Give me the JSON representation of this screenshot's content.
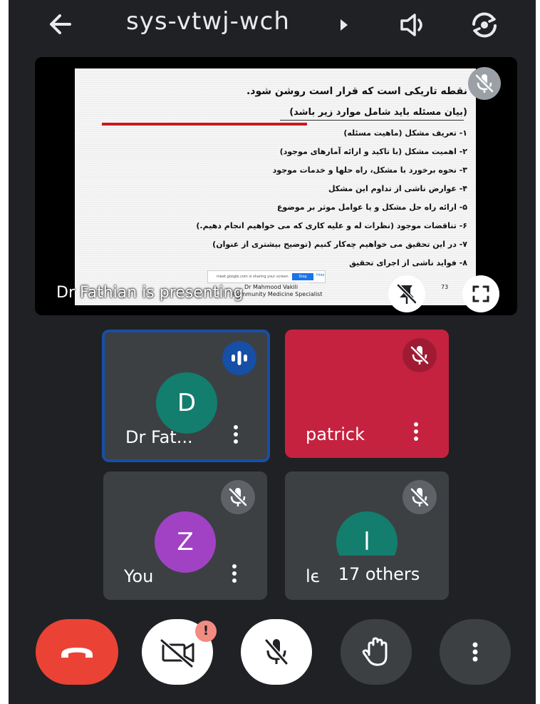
{
  "header": {
    "title": "sys-vtwj-wch"
  },
  "presentation": {
    "presenter_label": "Dr Fathian is presenting",
    "slide": {
      "lines": [
        "نقطه تاریکی  است که قرار است روشن شود.",
        "(بیان مسئله باید شامل موارد زیر باشد)",
        "۱- تعریف مشکل (ماهیت مسئله)",
        "۲- اهمیت مشکل (با تاکید و ارائه آمارهای موجود)",
        "۳- نحوه برخورد با مشکل، راه حلها و خدمات موجود",
        "۴- عوارض ناشی از تداوم این مشکل",
        "۵- ارائه راه حل مشکل و یا عوامل موثر بر موضوع",
        "۶- تناقضات موجود (نظرات له و علیه کاری که می خواهیم انجام دهیم.)",
        "۷- در این تحقیق می خواهیم چه‌کار کنیم (توضیح بیشتری از عنوان)",
        "۸- فواید ناشی از اجرای تحقیق"
      ],
      "share_bar_text": "meet.google.com is sharing your screen",
      "share_stop": "Stop sharing",
      "share_hide": "Hide",
      "author_line1": "Dr Mahmood Vakili",
      "author_line2": "Community Medicine Specialist",
      "page_number": "73"
    }
  },
  "participants": [
    {
      "name": "Dr Fat...",
      "initial": "D",
      "avatar_color": "#137d6e",
      "speaking": true
    },
    {
      "name": "patrick",
      "muted": true
    },
    {
      "name": "You",
      "initial": "Z",
      "avatar_color": "#a142c4",
      "muted": true
    },
    {
      "name": "leila",
      "initial": "l",
      "avatar_color": "#137d6e",
      "muted": true
    }
  ],
  "others_label": "17 others",
  "colors": {
    "background": "#202124",
    "tile": "#3c4043",
    "patrick_tile": "#c5223f",
    "active_border": "#174ea6",
    "hangup": "#ea4335"
  },
  "controls": {
    "alert_badge": "!"
  }
}
